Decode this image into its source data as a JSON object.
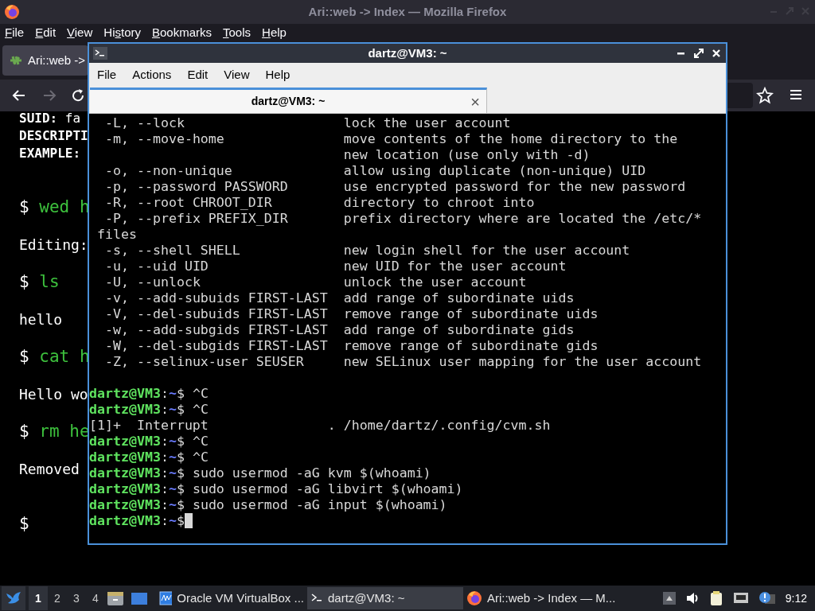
{
  "firefox": {
    "title": "Ari::web -> Index — Mozilla Firefox",
    "menu": [
      {
        "accel": "F",
        "after": "ile"
      },
      {
        "accel": "E",
        "after": "dit"
      },
      {
        "accel": "V",
        "after": "iew"
      },
      {
        "before": "Hi",
        "accel": "s",
        "after": "tory"
      },
      {
        "accel": "B",
        "after": "ookmarks"
      },
      {
        "accel": "T",
        "after": "ools"
      },
      {
        "accel": "H",
        "after": "elp"
      }
    ],
    "tab": {
      "label": "Ari::web ->"
    },
    "forward_disabled": true,
    "content": [
      {
        "kind": "heading",
        "text": "**SUID:** fa"
      },
      {
        "kind": "heading",
        "text": "**DESCRIPTI**"
      },
      {
        "kind": "heading",
        "text": "**EXAMPLE:**"
      },
      {
        "kind": "command",
        "sign": "$",
        "text": "wed h"
      },
      {
        "kind": "output",
        "text": "Editing:"
      },
      {
        "kind": "command",
        "sign": "$",
        "text": "ls"
      },
      {
        "kind": "output",
        "text": "hello"
      },
      {
        "kind": "command",
        "sign": "$",
        "text": "cat h"
      },
      {
        "kind": "output",
        "text": "Hello wo"
      },
      {
        "kind": "command",
        "sign": "$",
        "text": "rm he"
      },
      {
        "kind": "output",
        "text": "Removed"
      },
      {
        "kind": "command",
        "sign": "$"
      }
    ]
  },
  "terminal": {
    "title": "dartz@VM3: ~",
    "menu": [
      "File",
      "Actions",
      "Edit",
      "View",
      "Help"
    ],
    "tab": {
      "label": "dartz@VM3: ~",
      "close": "×"
    },
    "help": [
      {
        "kind": "option",
        "option": "-L, --lock",
        "description": "lock the user account"
      },
      {
        "kind": "option",
        "option": "-m, --move-home",
        "description": "move contents of the home directory to the"
      },
      {
        "kind": "continued",
        "description": "new location (use only with -d)"
      },
      {
        "kind": "option",
        "option": "-o, --non-unique",
        "description": "allow using duplicate (non-unique) UID"
      },
      {
        "kind": "option",
        "option": "-p, --password PASSWORD",
        "description": "use encrypted password for the new password"
      },
      {
        "kind": "option",
        "option": "-R, --root CHROOT_DIR",
        "description": "directory to chroot into"
      },
      {
        "kind": "option",
        "option": "-P, --prefix PREFIX_DIR",
        "description": "prefix directory where are located the /etc/*"
      },
      {
        "kind": "wrap",
        "text": "files"
      },
      {
        "kind": "option",
        "option": "-s, --shell SHELL",
        "description": "new login shell for the user account"
      },
      {
        "kind": "option",
        "option": "-u, --uid UID",
        "description": "new UID for the user account"
      },
      {
        "kind": "option",
        "option": "-U, --unlock",
        "description": "unlock the user account"
      },
      {
        "kind": "option",
        "option": "-v, --add-subuids FIRST-LAST",
        "description": "add range of subordinate uids"
      },
      {
        "kind": "option",
        "option": "-V, --del-subuids FIRST-LAST",
        "description": "remove range of subordinate uids"
      },
      {
        "kind": "option",
        "option": "-w, --add-subgids FIRST-LAST",
        "description": "add range of subordinate gids"
      },
      {
        "kind": "option",
        "option": "-W, --del-subgids FIRST-LAST",
        "description": "remove range of subordinate gids"
      },
      {
        "kind": "option",
        "option": "-Z, --selinux-user SEUSER",
        "description": "new SELinux user mapping for the user account"
      }
    ],
    "session": [
      {
        "kind": "prompt",
        "user_host": "dartz@VM3",
        "separator": ":",
        "path": "~",
        "sign": "$",
        "command": "^C",
        "cursor": false
      },
      {
        "kind": "prompt",
        "user_host": "dartz@VM3",
        "separator": ":",
        "path": "~",
        "sign": "$",
        "command": "^C",
        "cursor": false
      },
      {
        "kind": "job",
        "status": "[1]+  Interrupt",
        "command": ". /home/dartz/.config/cvm.sh"
      },
      {
        "kind": "prompt",
        "user_host": "dartz@VM3",
        "separator": ":",
        "path": "~",
        "sign": "$",
        "command": "^C",
        "cursor": false
      },
      {
        "kind": "prompt",
        "user_host": "dartz@VM3",
        "separator": ":",
        "path": "~",
        "sign": "$",
        "command": "^C",
        "cursor": false
      },
      {
        "kind": "prompt",
        "user_host": "dartz@VM3",
        "separator": ":",
        "path": "~",
        "sign": "$",
        "command": "sudo usermod -aG kvm $(whoami)",
        "cursor": false
      },
      {
        "kind": "prompt",
        "user_host": "dartz@VM3",
        "separator": ":",
        "path": "~",
        "sign": "$",
        "command": "sudo usermod -aG libvirt $(whoami)",
        "cursor": false
      },
      {
        "kind": "prompt",
        "user_host": "dartz@VM3",
        "separator": ":",
        "path": "~",
        "sign": "$",
        "command": "sudo usermod -aG input $(whoami)",
        "cursor": false
      },
      {
        "kind": "prompt",
        "user_host": "dartz@VM3",
        "separator": ":",
        "path": "~",
        "sign": "$",
        "cursor": true
      }
    ]
  },
  "taskbar": {
    "workspaces": [
      {
        "label": "1",
        "selected": true
      },
      {
        "label": "2",
        "selected": false
      },
      {
        "label": "3",
        "selected": false
      },
      {
        "label": "4",
        "selected": false
      }
    ],
    "tasks": [
      {
        "kind": "virtualbox",
        "label": "Oracle VM VirtualBox ...",
        "selected": false
      },
      {
        "kind": "terminal",
        "label": "dartz@VM3: ~",
        "selected": true
      },
      {
        "kind": "firefox",
        "label": "Ari::web -> Index — M...",
        "selected": false
      }
    ],
    "clock": "9:12"
  }
}
